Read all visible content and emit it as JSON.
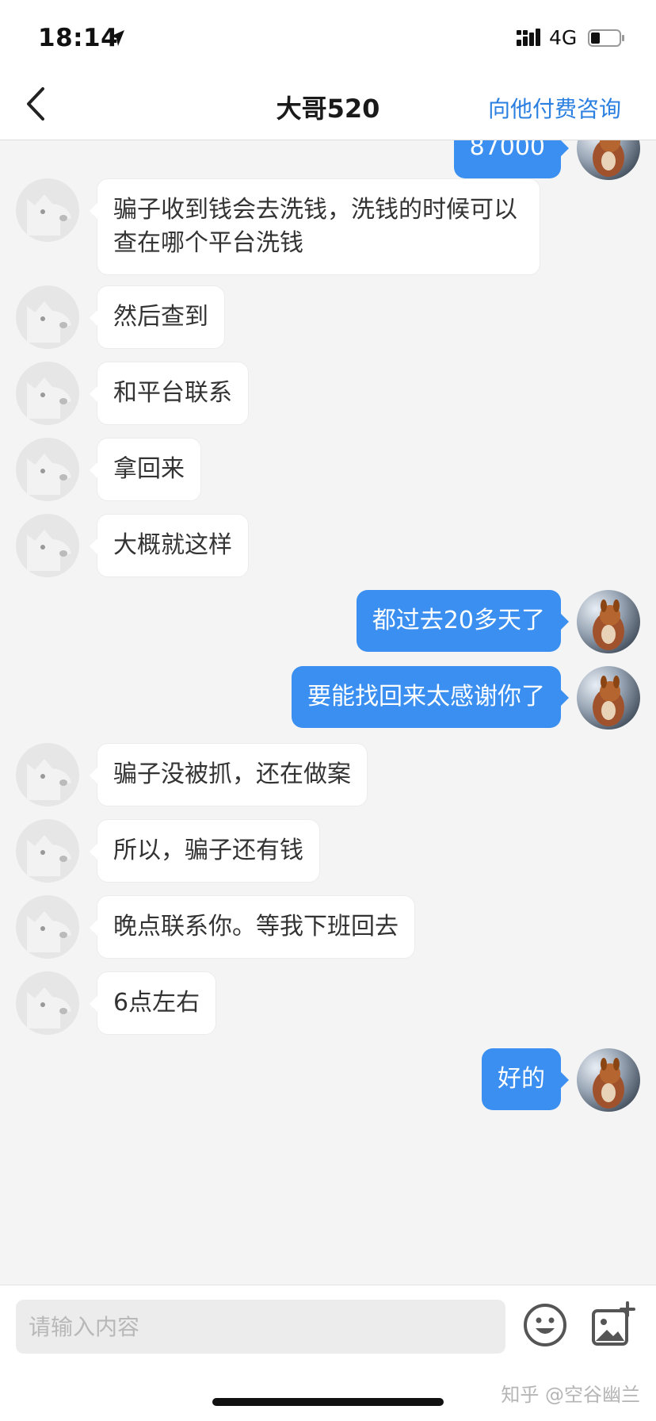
{
  "status_bar": {
    "time": "18:14",
    "network": "4G"
  },
  "nav": {
    "title": "大哥520",
    "action_label": "向他付费咨询"
  },
  "messages": [
    {
      "side": "out",
      "text": "87000"
    },
    {
      "side": "in",
      "text": "骗子收到钱会去洗钱，洗钱的时候可以查在哪个平台洗钱"
    },
    {
      "side": "in",
      "text": "然后查到"
    },
    {
      "side": "in",
      "text": "和平台联系"
    },
    {
      "side": "in",
      "text": "拿回来"
    },
    {
      "side": "in",
      "text": "大概就这样"
    },
    {
      "side": "out",
      "text": "都过去20多天了"
    },
    {
      "side": "out",
      "text": "要能找回来太感谢你了"
    },
    {
      "side": "in",
      "text": "骗子没被抓，还在做案"
    },
    {
      "side": "in",
      "text": "所以，骗子还有钱"
    },
    {
      "side": "in",
      "text": "晚点联系你。等我下班回去"
    },
    {
      "side": "in",
      "text": "6点左右"
    },
    {
      "side": "out",
      "text": "好的"
    }
  ],
  "input": {
    "placeholder": "请输入内容"
  },
  "watermark": "知乎 @空谷幽兰",
  "colors": {
    "accent": "#2a7fe0",
    "outgoing_bubble": "#3a8ff0",
    "incoming_bubble": "#ffffff",
    "background": "#f4f4f4"
  },
  "icons": {
    "back": "chevron-left-icon",
    "emoji": "smiley-icon",
    "image": "add-image-icon",
    "signal": "signal-icon",
    "battery": "battery-icon",
    "location": "location-arrow-icon"
  }
}
